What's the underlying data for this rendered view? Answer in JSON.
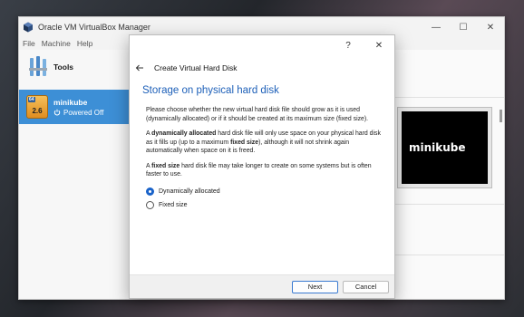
{
  "manager": {
    "title": "Oracle VM VirtualBox Manager",
    "window_controls": {
      "minimize": "—",
      "maximize": "☐",
      "close": "✕"
    },
    "menu": [
      "File",
      "Machine",
      "Help"
    ],
    "tools_label": "Tools",
    "vm": {
      "name": "minikube",
      "status": "Powered Off",
      "badge_top": "64",
      "badge_version": "2.6"
    },
    "preview_text": "minikube",
    "accent_color": "#3d8fd6"
  },
  "dialog": {
    "help_label": "?",
    "close_label": "✕",
    "wizard_title": "Create Virtual Hard Disk",
    "heading": "Storage on physical hard disk",
    "intro": "Please choose whether the new virtual hard disk file should grow as it is used (dynamically allocated) or if it should be created at its maximum size (fixed size).",
    "dynamic_parts": {
      "a": "A ",
      "b": "dynamically allocated",
      "c": " hard disk file will only use space on your physical hard disk as it fills up (up to a maximum ",
      "d": "fixed size",
      "e": "), although it will not shrink again automatically when space on it is freed."
    },
    "fixed_parts": {
      "a": "A ",
      "b": "fixed size",
      "c": " hard disk file may take longer to create on some systems but is often faster to use."
    },
    "options": [
      {
        "label": "Dynamically allocated",
        "selected": true
      },
      {
        "label": "Fixed size",
        "selected": false
      }
    ],
    "buttons": {
      "next": "Next",
      "cancel": "Cancel"
    },
    "heading_color": "#1c5fb8"
  }
}
